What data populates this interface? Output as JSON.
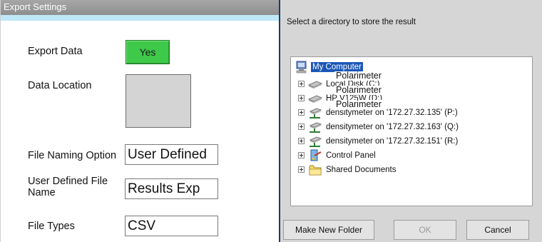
{
  "left_panel": {
    "title": "Export Settings",
    "fields": {
      "export_data": {
        "label": "Export Data",
        "button_label": "Yes"
      },
      "data_location": {
        "label": "Data Location"
      },
      "file_naming_option": {
        "label": "File Naming Option",
        "value": "User Defined"
      },
      "user_defined_file_name": {
        "label": "User Defined File Name",
        "value": "Results Exp"
      },
      "file_types": {
        "label": "File Types",
        "value": "CSV"
      }
    },
    "colors": {
      "title_bar": "#9a9a9a",
      "title_accent": "#bfe8f8",
      "yes_button": "#3ec94a"
    }
  },
  "dialog": {
    "prompt": "Select a directory to store the result",
    "tree": [
      {
        "label": "My Computer",
        "icon": "computer-icon",
        "selected": true
      },
      {
        "label": "Local Disk (C:)",
        "icon": "drive-icon"
      },
      {
        "label": "HP V125W (D:)",
        "icon": "drive-icon"
      },
      {
        "label": "densitymeter on '172.27.32.135' (P:)",
        "icon": "network-drive-icon"
      },
      {
        "label": "densitymeter on '172.27.32.163' (Q:)",
        "icon": "network-drive-icon"
      },
      {
        "label": "densitymeter on '172.27.32.151' (R:)",
        "icon": "network-drive-icon"
      },
      {
        "label": "Control Panel",
        "icon": "control-panel-icon"
      },
      {
        "label": "Shared Documents",
        "icon": "folder-icon"
      }
    ],
    "overlays": [
      "Polarimeter",
      "Polarimeter",
      "Polarimeter"
    ],
    "buttons": {
      "make_new_folder": "Make New Folder",
      "ok": "OK",
      "cancel": "Cancel"
    },
    "colors": {
      "selection": "#1b57b6",
      "dialog_bg": "#d6d6d6"
    }
  }
}
